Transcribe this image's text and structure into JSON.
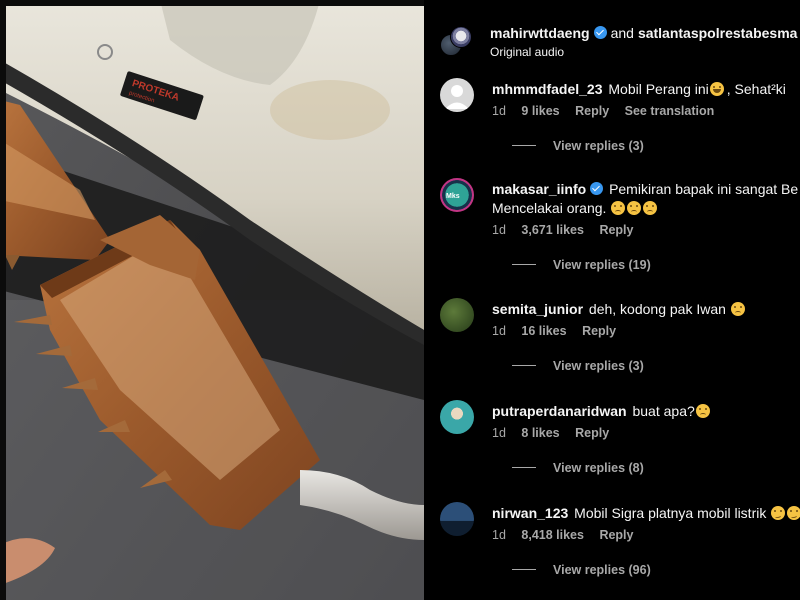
{
  "post": {
    "owner": "mahirwttdaeng",
    "conjunction": "and",
    "collaborator": "satlantaspolrestabesma",
    "audio": "Original audio",
    "media_label": "PROTEKA protection"
  },
  "comments": [
    {
      "user": "mhmmdfadel_23",
      "verified": false,
      "text": "Mobil Perang ini",
      "emoji": "laugh",
      "text_after": ", Sehat²ki",
      "time": "1d",
      "likes": "9 likes",
      "reply": "Reply",
      "see_translation": "See translation",
      "view_replies": "View replies (3)",
      "avatar_color": "#d9d9d9"
    },
    {
      "user": "makasar_iinfo",
      "verified": true,
      "text": "Pemikiran bapak ini sangat Be",
      "line2": "Mencelakai orang.",
      "time": "1d",
      "likes": "3,671 likes",
      "reply": "Reply",
      "view_replies": "View replies (19)",
      "avatar_color": "#2a8a7a"
    },
    {
      "user": "semita_junior",
      "verified": false,
      "text": "deh, kodong pak Iwan",
      "time": "1d",
      "likes": "16 likes",
      "reply": "Reply",
      "view_replies": "View replies (3)",
      "avatar_color": "#3f5a2a"
    },
    {
      "user": "putraperdanaridwan",
      "verified": false,
      "text": "buat apa?",
      "time": "1d",
      "likes": "8 likes",
      "reply": "Reply",
      "view_replies": "View replies (8)",
      "avatar_color": "#3aa7a8"
    },
    {
      "user": "nirwan_123",
      "verified": false,
      "text": "Mobil Sigra platnya mobil listrik",
      "time": "1d",
      "likes": "8,418 likes",
      "reply": "Reply",
      "view_replies": "View replies (96)",
      "avatar_color": "#1f3a5a"
    }
  ],
  "colors": {
    "panel_bg": "#000000",
    "text_primary": "#f5f5f5",
    "text_secondary": "#a8a8a8",
    "verified": "#3897f0"
  }
}
